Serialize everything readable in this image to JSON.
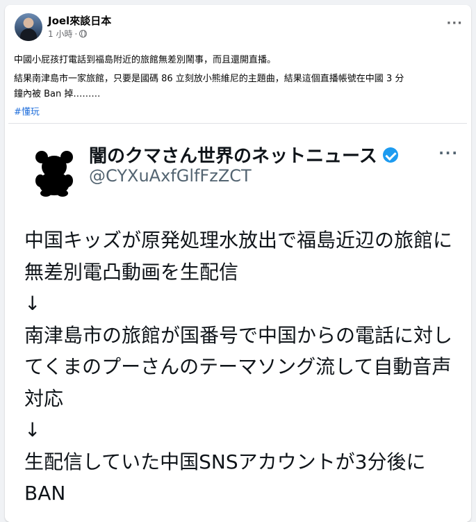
{
  "post": {
    "author": "Joel來談日本",
    "time": "1 小時",
    "separator": "·",
    "more_icon": "more-horizontal-icon",
    "privacy_icon": "globe-icon",
    "text_line1": "中國小屁孩打電話到福島附近的旅館無差別鬧事，而且還開直播。",
    "text_line2": "結果南津島市一家旅館，只要是國碼 86 立刻放小熊維尼的主題曲，結果這個直播帳號在中國 3 分",
    "text_line3": "鐘內被 Ban 掉………",
    "hashtag": "#懂玩"
  },
  "tweet": {
    "display_name": "闇のクマさん世界のネットニュース",
    "handle": "@CYXuAxfGlfFzZCT",
    "verified_icon": "verified-badge-icon",
    "more_icon": "more-horizontal-icon",
    "avatar_icon": "black-bear-icon",
    "lines": [
      "中国キッズが原発処理水放出で福島近辺の旅館に",
      "無差別電凸動画を生配信",
      "↓",
      "南津島市の旅館が国番号で中国からの電話に対し",
      "てくまのプーさんのテーマソング流して自動音声",
      "対応",
      "↓",
      "生配信していた中国SNSアカウントが3分後に",
      "BAN"
    ]
  }
}
